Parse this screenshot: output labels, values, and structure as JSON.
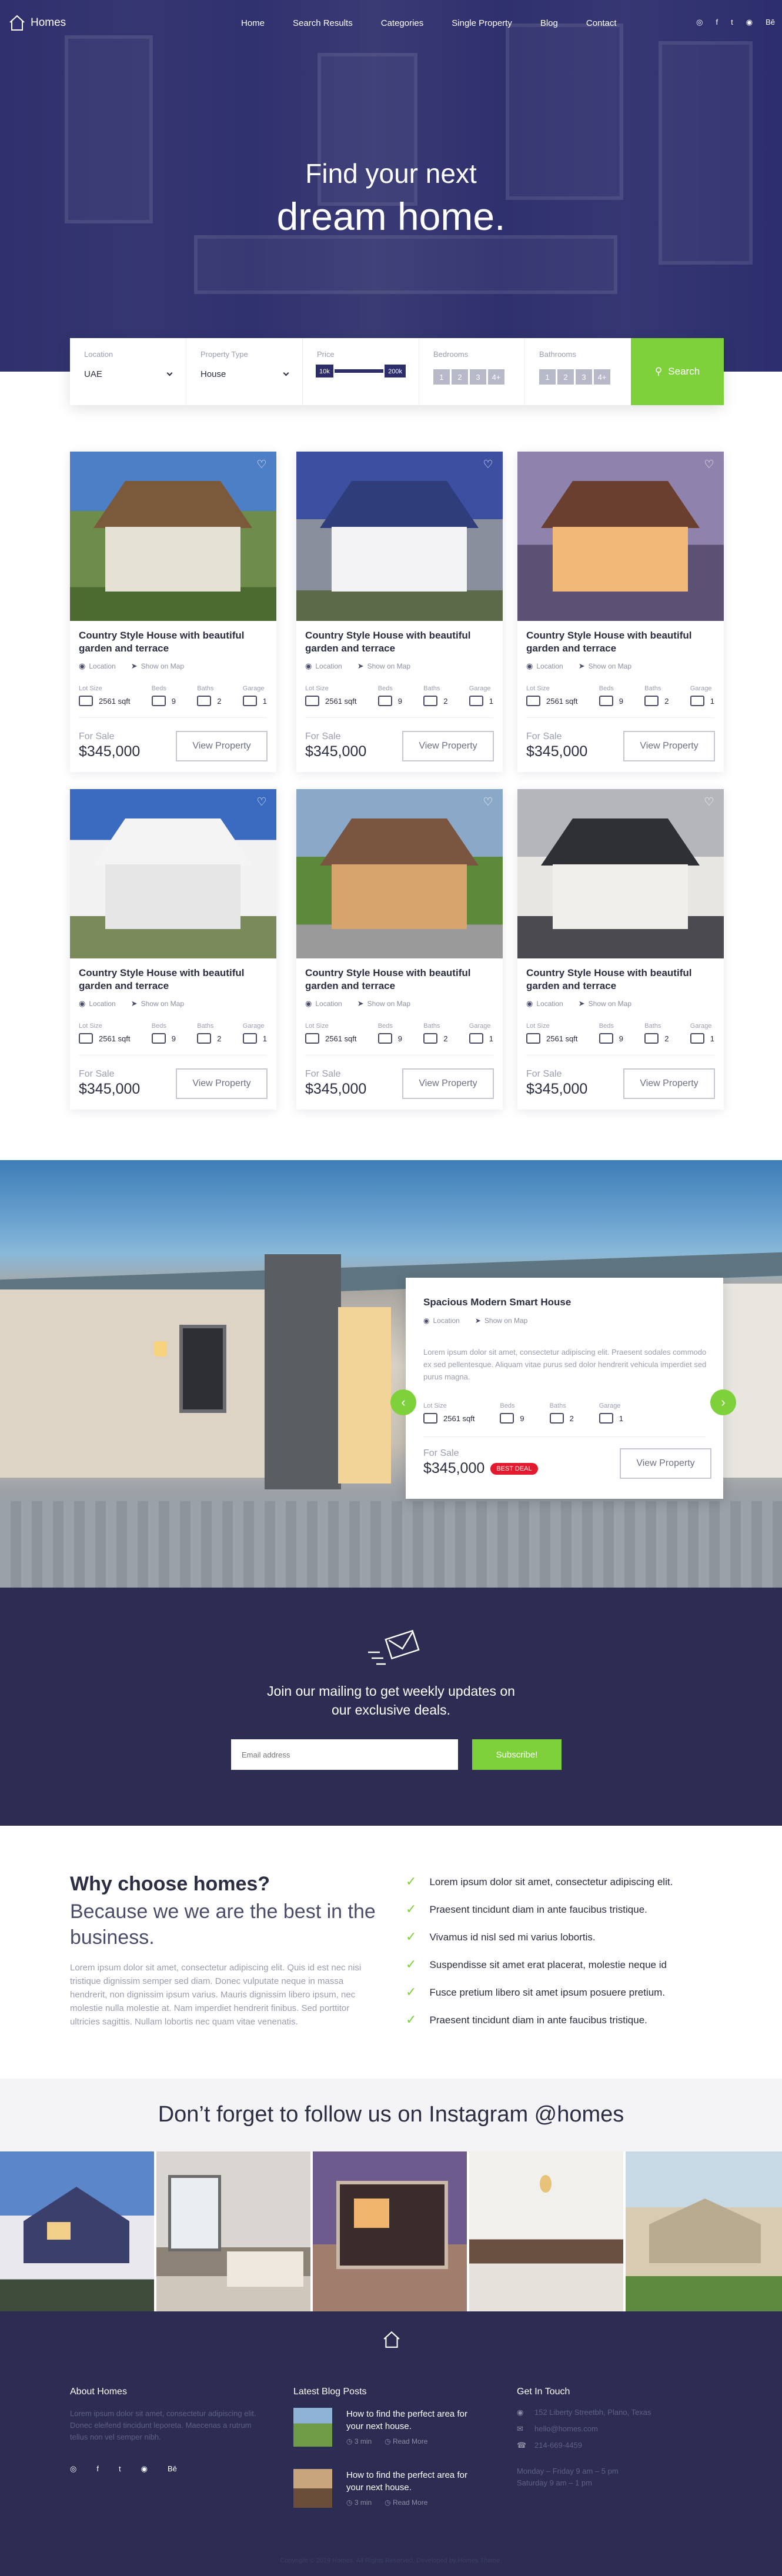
{
  "brand": "Homes",
  "nav": [
    "Home",
    "Search Results",
    "Categories",
    "Single Property",
    "Blog",
    "Contact"
  ],
  "top_socials": [
    "dribbble-icon",
    "facebook-icon",
    "twitter-icon",
    "instagram-icon",
    "behance-icon"
  ],
  "top_socials_glyphs": [
    "◎",
    "f",
    "t",
    "◉",
    "Bē"
  ],
  "hero": {
    "line1": "Find your next",
    "line2": "dream home."
  },
  "search": {
    "location_label": "Location",
    "location_value": "UAE",
    "type_label": "Property Type",
    "type_value": "House",
    "price_label": "Price",
    "price_min": "10k",
    "price_max": "200k",
    "bedrooms_label": "Bedrooms",
    "bathrooms_label": "Bathrooms",
    "counts": [
      "1",
      "2",
      "3",
      "4+"
    ],
    "button": "Search"
  },
  "card_labels": {
    "location": "Location",
    "map": "Show on Map",
    "lot": "Lot Size",
    "beds": "Beds",
    "baths": "Baths",
    "garage": "Garage",
    "for_sale": "For Sale",
    "view": "View Property"
  },
  "listings": [
    {
      "title": "Country Style House with beautiful garden and terrace",
      "lot": "2561 sqft",
      "beds": "9",
      "baths": "2",
      "garage": "1",
      "price": "$345,000",
      "photo": "house-1"
    },
    {
      "title": "Country Style House with beautiful garden and terrace",
      "lot": "2561 sqft",
      "beds": "9",
      "baths": "2",
      "garage": "1",
      "price": "$345,000",
      "photo": "house-2"
    },
    {
      "title": "Country Style House with beautiful garden and terrace",
      "lot": "2561 sqft",
      "beds": "9",
      "baths": "2",
      "garage": "1",
      "price": "$345,000",
      "photo": "house-3"
    },
    {
      "title": "Country Style House with beautiful garden and terrace",
      "lot": "2561 sqft",
      "beds": "9",
      "baths": "2",
      "garage": "1",
      "price": "$345,000",
      "photo": "house-4"
    },
    {
      "title": "Country Style House with beautiful garden and terrace",
      "lot": "2561 sqft",
      "beds": "9",
      "baths": "2",
      "garage": "1",
      "price": "$345,000",
      "photo": "house-5"
    },
    {
      "title": "Country Style House with beautiful garden and terrace",
      "lot": "2561 sqft",
      "beds": "9",
      "baths": "2",
      "garage": "1",
      "price": "$345,000",
      "photo": "house-6"
    }
  ],
  "featured": {
    "title": "Spacious Modern Smart House",
    "description": "Lorem ipsum dolor sit amet, consectetur adipiscing elit. Praesent sodales commodo ex sed pellentesque. Aliquam vitae purus sed dolor hendrerit vehicula imperdiet sed purus magna.",
    "lot": "2561 sqft",
    "beds": "9",
    "baths": "2",
    "garage": "1",
    "price": "$345,000",
    "badge": "BEST DEAL"
  },
  "newsletter": {
    "title_line1": "Join our mailing to get weekly updates on",
    "title_line2": "our exclusive deals.",
    "placeholder": "Email address",
    "button": "Subscribe!"
  },
  "why": {
    "heading": "Why choose homes?",
    "subheading": "Because we we are the best in the business.",
    "body": "Lorem ipsum dolor sit amet, consectetur adipiscing elit. Quis id est nec nisi tristique dignissim semper sed diam. Donec vulputate neque in massa hendrerit, non dignissim ipsum varius. Mauris dignissim libero ipsum, nec molestie nulla molestie at. Nam imperdiet hendrerit finibus. Sed porttitor ultricies sagittis. Nullam lobortis nec quam vitae venenatis.",
    "points": [
      "Lorem ipsum dolor sit amet, consectetur adipiscing elit.",
      "Praesent tincidunt diam in ante faucibus tristique.",
      "Vivamus id nisl sed mi varius lobortis.",
      "Suspendisse sit amet erat placerat, molestie neque id",
      "Fusce pretium libero sit amet ipsum posuere pretium.",
      "Praesent tincidunt diam in ante faucibus tristique."
    ]
  },
  "instagram": {
    "title": "Don’t forget to follow us on Instagram @homes"
  },
  "footer": {
    "about_title": "About Homes",
    "about_text": "Lorem ipsum dolor sit amet, consectetur adipiscing elit. Donec eleifend tincidunt leporeta. Maecenas a rutrum tellus non vel semper nibh.",
    "blog_title": "Latest Blog Posts",
    "posts": [
      {
        "title": "How to find the perfect area for your next house.",
        "time": "3 min",
        "more": "Read More"
      },
      {
        "title": "How to find the perfect area for your next house.",
        "time": "3 min",
        "more": "Read More"
      }
    ],
    "contact_title": "Get In Touch",
    "address": "152 Liberty Streetbh, Plano, Texas",
    "email": "hello@homes.com",
    "phone": "214-669-4459",
    "hours1": "Monday – Friday 9 am – 5 pm",
    "hours2": "Saturday 9 am – 1 pm",
    "copyright": "Copyright © 2019 Homes. All Rights Reserved. Developed by Homes Theme."
  }
}
